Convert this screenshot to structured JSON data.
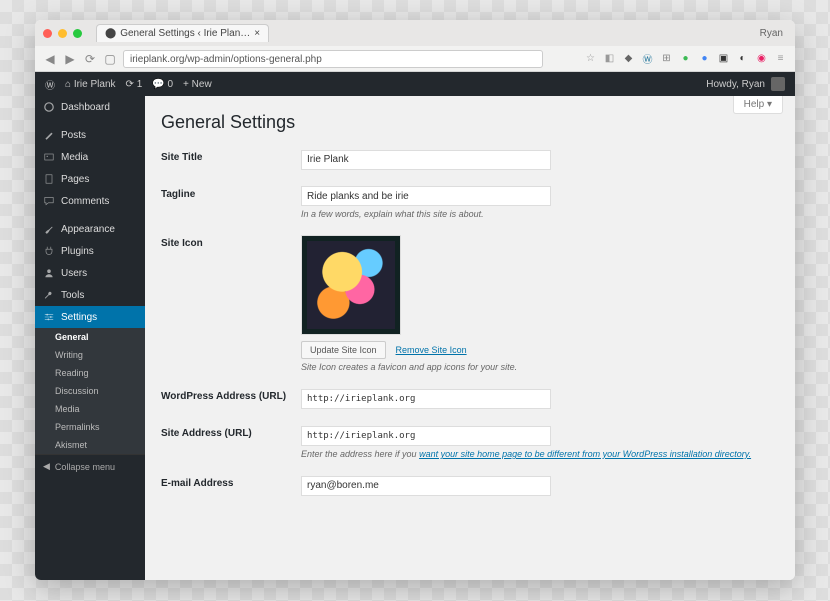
{
  "browser": {
    "tab_title": "General Settings ‹ Irie Plan…",
    "profile": "Ryan",
    "url": "irieplank.org/wp-admin/options-general.php"
  },
  "adminbar": {
    "site_name": "Irie Plank",
    "updates": "1",
    "comments": "0",
    "new": "New",
    "howdy": "Howdy, Ryan"
  },
  "sidebar": {
    "dashboard": "Dashboard",
    "posts": "Posts",
    "media": "Media",
    "pages": "Pages",
    "comments": "Comments",
    "appearance": "Appearance",
    "plugins": "Plugins",
    "users": "Users",
    "tools": "Tools",
    "settings": "Settings",
    "sub": {
      "general": "General",
      "writing": "Writing",
      "reading": "Reading",
      "discussion": "Discussion",
      "media": "Media",
      "permalinks": "Permalinks",
      "akismet": "Akismet"
    },
    "collapse": "Collapse menu"
  },
  "page": {
    "help": "Help ▾",
    "title": "General Settings",
    "labels": {
      "site_title": "Site Title",
      "tagline": "Tagline",
      "site_icon": "Site Icon",
      "wp_url": "WordPress Address (URL)",
      "site_url": "Site Address (URL)",
      "email": "E-mail Address"
    },
    "values": {
      "site_title": "Irie Plank",
      "tagline": "Ride planks and be irie",
      "wp_url": "http://irieplank.org",
      "site_url": "http://irieplank.org",
      "email": "ryan@boren.me"
    },
    "desc": {
      "tagline": "In a few words, explain what this site is about.",
      "site_icon": "Site Icon creates a favicon and app icons for your site.",
      "site_url_pre": "Enter the address here if you ",
      "site_url_link": "want your site home page to be different from your WordPress installation directory."
    },
    "buttons": {
      "update_icon": "Update Site Icon",
      "remove_icon": "Remove Site Icon"
    }
  }
}
